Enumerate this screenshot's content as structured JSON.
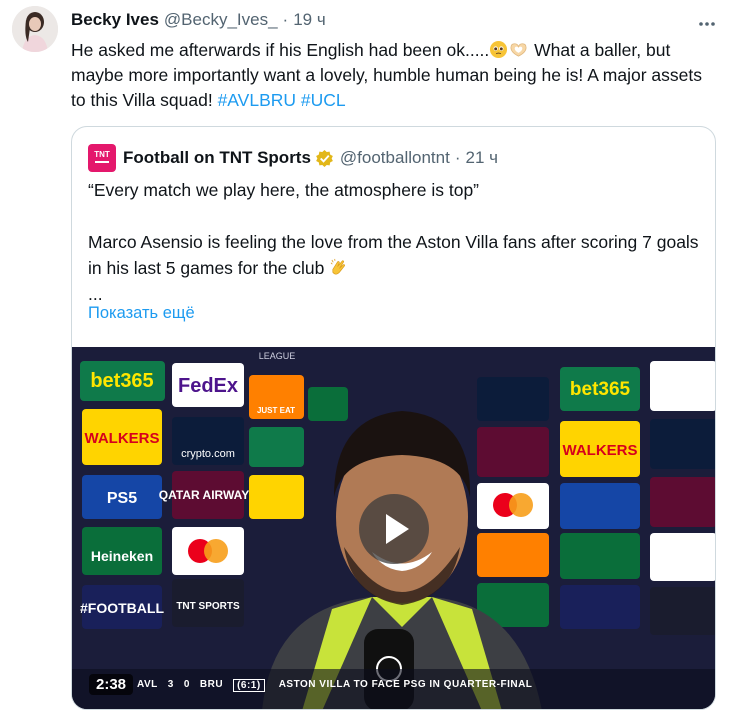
{
  "tweet": {
    "author_name": "Becky Ives",
    "author_handle": "@Becky_Ives_",
    "separator": "·",
    "time": "19 ч",
    "text_part1": "He asked me afterwards if his English had been ok.....",
    "text_part2": " What a baller, but maybe more importantly want a lovely, humble human being he is!  A major assets to this Villa squad! ",
    "hashtag1": "#AVLBRU",
    "hashtag2": "#UCL",
    "emojis": [
      "pleading-face-emoji",
      "heart-hands-emoji"
    ]
  },
  "quote": {
    "author_name": "Football on TNT Sports",
    "author_handle": "@footballontnt",
    "separator": "·",
    "time": "21 ч",
    "paragraph1": "“Every match we play here, the atmosphere is top”",
    "paragraph2": "Marco Asensio is feeling the love from the Aston Villa fans after scoring 7 goals in his last 5 games for the club ",
    "ellipsis": "...",
    "show_more": "Показать ещё",
    "avatar_text": "TNT"
  },
  "video": {
    "duration": "2:38",
    "ticker_home": "AVL",
    "ticker_home_score": "3",
    "ticker_away_score": "0",
    "ticker_away": "BRU",
    "ticker_aggregate": "(6:1)",
    "ticker_note": "ASTON VILLA TO FACE PSG IN QUARTER-FINAL",
    "board_labels": [
      "bet365",
      "FedEx",
      "JUST EAT",
      "Heineken",
      "WALKERS",
      "crypto.com",
      "QATAR AIRWAYS",
      "PS5",
      "#FOOTBALL",
      "TNT SPORTS",
      "LEAGUE"
    ]
  },
  "colors": {
    "link": "#1d9bf0",
    "text": "#0f1419",
    "muted": "#536471",
    "border": "#cfd9de",
    "verified_gold": "#e2b719",
    "tnt_pink": "#e4186c"
  }
}
